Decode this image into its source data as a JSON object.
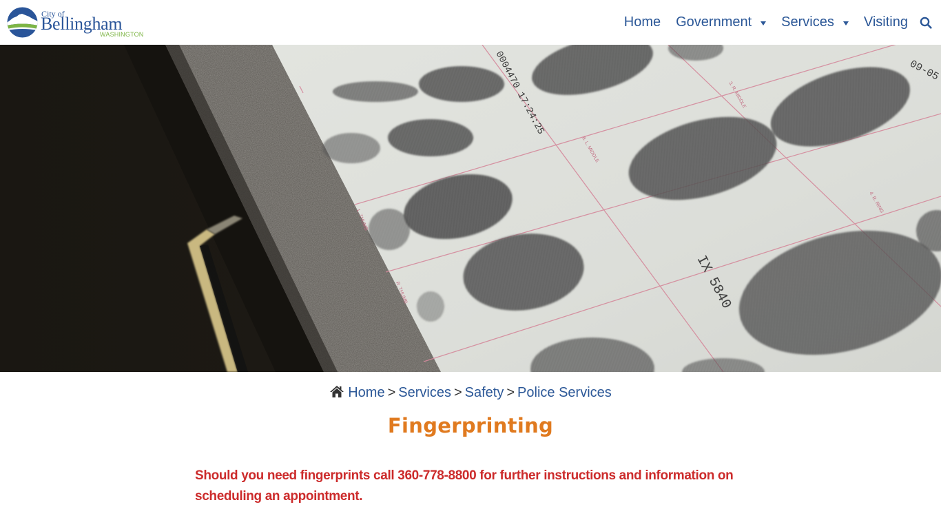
{
  "logo": {
    "city_of": "City of",
    "name": "Bellingham",
    "state": "WASHINGTON",
    "colors": {
      "blue": "#2a5599",
      "green": "#7db545"
    }
  },
  "nav": {
    "items": [
      {
        "label": "Home",
        "has_dropdown": false
      },
      {
        "label": "Government",
        "has_dropdown": true
      },
      {
        "label": "Services",
        "has_dropdown": true
      },
      {
        "label": "Visiting",
        "has_dropdown": false
      }
    ],
    "search_icon": "search-icon",
    "color": "#2b5797"
  },
  "hero": {
    "image_description": "Close-up of a fingerprint card on a speckled countertop next to a dark drawer with a metal handle",
    "card_text": {
      "stamp": "0004470 17:24:25",
      "code": "IX 5840",
      "date": "09-05",
      "labels": [
        "L. THUMB",
        "R. THUMB",
        "3. R. MIDDLE",
        "8. L. MIDDLE",
        "4. R. RING"
      ]
    }
  },
  "breadcrumb": {
    "home_icon": "home-icon",
    "items": [
      "Home",
      "Services",
      "Safety",
      "Police Services"
    ],
    "separator": ">"
  },
  "page": {
    "title": "Fingerprinting",
    "title_color": "#e07a1f",
    "notice": "Should you need fingerprints call 360-778-8800 for further instructions and information on scheduling an appointment.",
    "notice_color": "#cc2b2b"
  }
}
